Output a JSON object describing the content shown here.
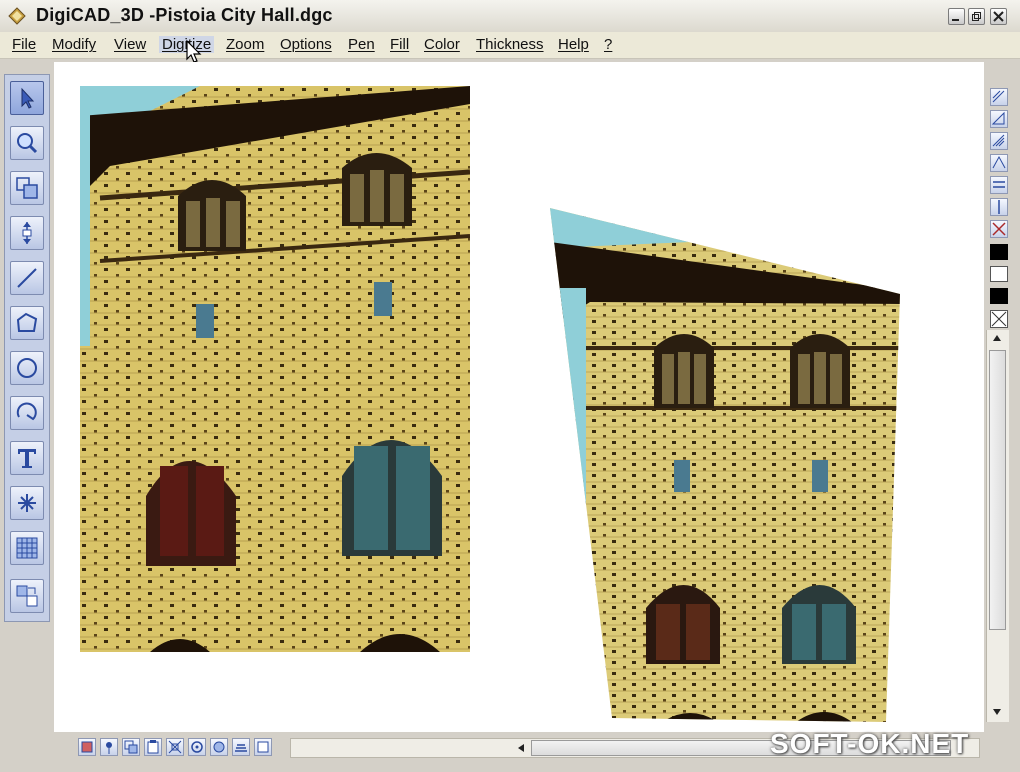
{
  "window": {
    "title": "DigiCAD_3D -Pistoia City Hall.dgc"
  },
  "menu": {
    "items": [
      {
        "label": "File"
      },
      {
        "label": "Modify"
      },
      {
        "label": "View"
      },
      {
        "label": "Digitize"
      },
      {
        "label": "Zoom"
      },
      {
        "label": "Options"
      },
      {
        "label": "Pen"
      },
      {
        "label": "Fill"
      },
      {
        "label": "Color"
      },
      {
        "label": "Thickness"
      },
      {
        "label": "Help"
      },
      {
        "label": "?"
      }
    ],
    "active": "Digitize"
  },
  "left_toolbar": {
    "tools": [
      {
        "icon": "pointer-arrow-icon",
        "selected": true
      },
      {
        "icon": "zoom-magnifier-icon"
      },
      {
        "icon": "resize-frame-icon"
      },
      {
        "icon": "vertical-scale-icon"
      },
      {
        "icon": "line-icon"
      },
      {
        "icon": "polygon-icon"
      },
      {
        "icon": "circle-icon"
      },
      {
        "icon": "arc-icon"
      },
      {
        "icon": "text-icon"
      },
      {
        "icon": "point-star-icon"
      },
      {
        "icon": "grid-icon"
      },
      {
        "icon": "image-transform-icon"
      }
    ]
  },
  "right_toolbar": {
    "tools": [
      "align-icon",
      "mirror-icon",
      "rotate-icon",
      "skew-icon",
      "distribute-icon",
      "vertical-align-icon",
      "cross-icon"
    ],
    "swatches": [
      "#000000",
      "#ffffff",
      "#000000"
    ]
  },
  "canvas": {
    "images": [
      {
        "name": "original-photo",
        "subject": "Pistoia City Hall facade"
      },
      {
        "name": "perspective-corrected-photo",
        "subject": "Pistoia City Hall facade"
      }
    ]
  },
  "colors": {
    "accent": "#c5cfe6",
    "chrome": "#d4d0c8",
    "stone": "#d8c878",
    "sky": "#8fcfd8"
  },
  "watermark": {
    "text": "SOFT-OK.NET"
  }
}
